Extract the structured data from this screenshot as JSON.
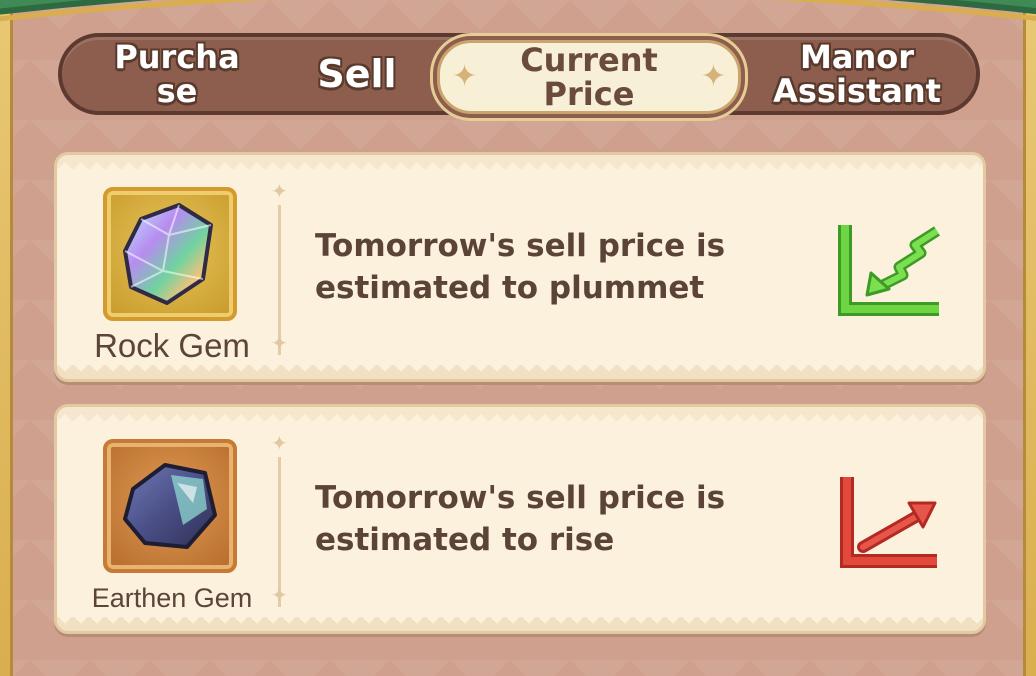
{
  "tabs": [
    {
      "label": "Purcha\nse",
      "selected": false
    },
    {
      "label": "Sell",
      "selected": false
    },
    {
      "label": "Current\nPrice",
      "selected": true
    },
    {
      "label": "Manor\nAssistant",
      "selected": false
    }
  ],
  "items": [
    {
      "name": "Rock Gem",
      "forecast": "Tomorrow's sell price is estimated to plummet",
      "trend": "down",
      "trend_color": "#5cc93a",
      "icon": "rock-gem-icon"
    },
    {
      "name": "Earthen Gem",
      "forecast": "Tomorrow's sell price is estimated to rise",
      "trend": "up",
      "trend_color": "#d9392e",
      "icon": "earthen-gem-icon"
    }
  ],
  "colors": {
    "background": "#cfa08d",
    "card": "#fbf1dc",
    "tab_bar": "#8d5e4e",
    "selected_tab": "#f7efd6",
    "text": "#5b4437"
  }
}
